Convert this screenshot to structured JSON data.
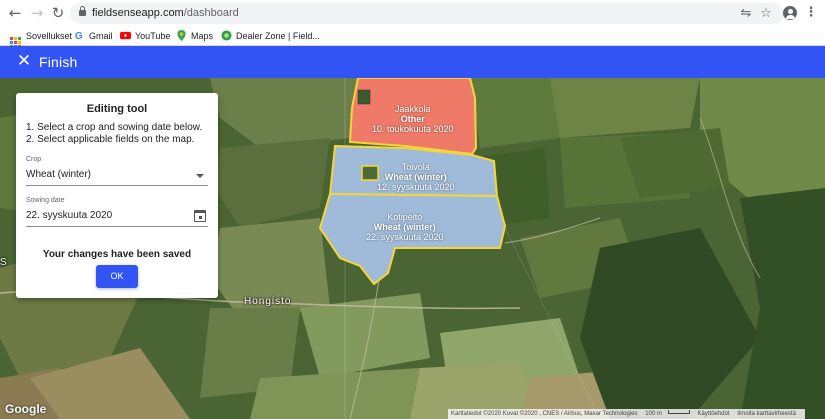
{
  "browser": {
    "url_host": "fieldsenseapp.com",
    "url_path": "/dashboard",
    "bookmarks": [
      {
        "label": "Sovellukset",
        "icon": "apps-grid-icon"
      },
      {
        "label": "Gmail",
        "icon": "google-icon"
      },
      {
        "label": "YouTube",
        "icon": "youtube-icon"
      },
      {
        "label": "Maps",
        "icon": "maps-pin-icon"
      },
      {
        "label": "Dealer Zone | Field...",
        "icon": "dealer-zone-icon"
      }
    ]
  },
  "appbar": {
    "title": "Finish",
    "color": "#3354f4"
  },
  "editing_tool": {
    "title": "Editing tool",
    "instruction_1": "1. Select a crop and sowing date below.",
    "instruction_2": "2. Select applicable fields on the map.",
    "crop_label": "Crop",
    "crop_value": "Wheat (winter)",
    "sowing_label": "Sowing date",
    "sowing_value": "22. syyskuuta 2020",
    "saved_message": "Your changes have been saved",
    "ok_label": "OK"
  },
  "fields": [
    {
      "name": "Jaakkola",
      "crop": "Other",
      "date": "10. toukokuuta 2020",
      "color": "#ef7a68"
    },
    {
      "name": "Toivola",
      "crop": "Wheat (winter)",
      "date": "12. syyskuuta 2020",
      "color": "#9fbbd9"
    },
    {
      "name": "Kotipelto",
      "crop": "Wheat (winter)",
      "date": "22. syyskuuta 2020",
      "color": "#9fbbd9"
    }
  ],
  "map": {
    "place_label": "Hongisto",
    "edge_label": "S",
    "google": "Google",
    "attribution": "Karttatiedot ©2020 Kuvat ©2020 , CNES / Airbus, Maxar Technologies",
    "scale": "100 m",
    "terms": "Käyttöehdot",
    "report": "Ilmoita karttavirheestä"
  }
}
